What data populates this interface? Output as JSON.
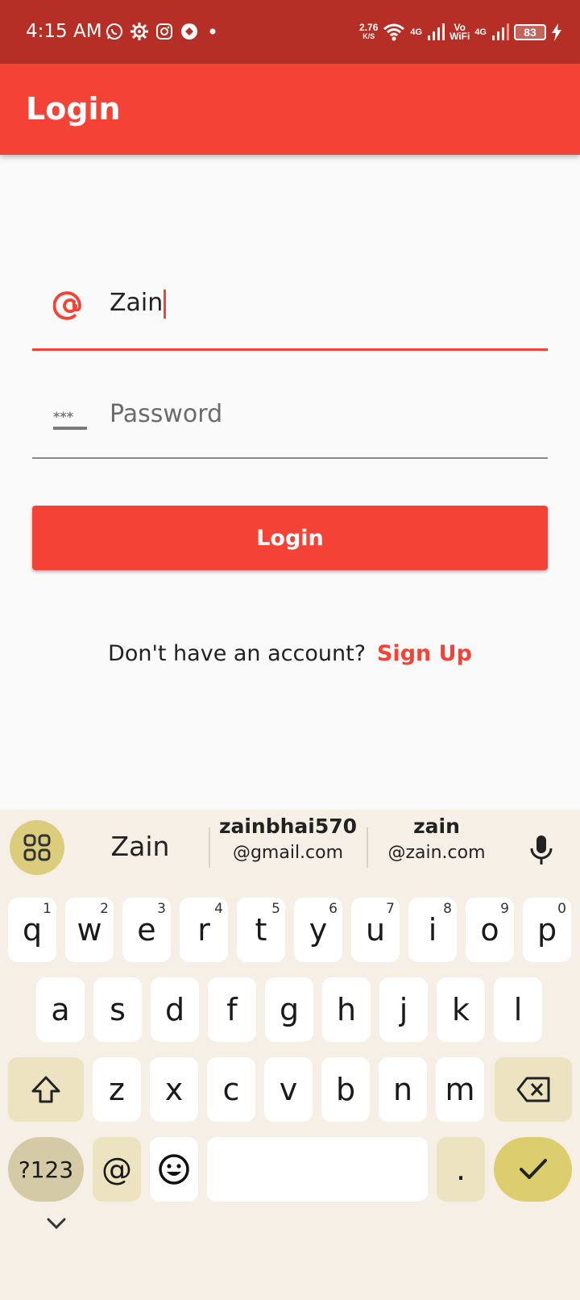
{
  "status_bar": {
    "time": "4:15 AM",
    "icons": [
      "whatsapp-icon",
      "settings-icon",
      "instagram-icon",
      "camera-app-icon",
      "dot-icon"
    ],
    "net_speed_value": "2.76",
    "net_speed_unit": "K/S",
    "net1": "4G",
    "volte": "Vo",
    "wifi_label": "WiFi",
    "net2": "4G",
    "battery": "83"
  },
  "appbar": {
    "title": "Login"
  },
  "form": {
    "email": {
      "icon": "at-icon",
      "value": "Zain"
    },
    "password": {
      "icon": "password-icon",
      "placeholder": "Password"
    },
    "login_label": "Login",
    "signup_prompt": "Don't have an account?",
    "signup_link": "Sign Up"
  },
  "keyboard": {
    "suggestions": [
      {
        "line1": "Zain"
      },
      {
        "line1": "zainbhai570",
        "line2": "@gmail.com"
      },
      {
        "line1": "zain",
        "line2": "@zain.com"
      }
    ],
    "rows": [
      [
        {
          "label": "q",
          "sup": "1"
        },
        {
          "label": "w",
          "sup": "2"
        },
        {
          "label": "e",
          "sup": "3"
        },
        {
          "label": "r",
          "sup": "4"
        },
        {
          "label": "t",
          "sup": "5"
        },
        {
          "label": "y",
          "sup": "6"
        },
        {
          "label": "u",
          "sup": "7"
        },
        {
          "label": "i",
          "sup": "8"
        },
        {
          "label": "o",
          "sup": "9"
        },
        {
          "label": "p",
          "sup": "0"
        }
      ],
      [
        {
          "label": "a"
        },
        {
          "label": "s"
        },
        {
          "label": "d"
        },
        {
          "label": "f"
        },
        {
          "label": "g"
        },
        {
          "label": "h"
        },
        {
          "label": "j"
        },
        {
          "label": "k"
        },
        {
          "label": "l"
        }
      ],
      [
        {
          "label": "z"
        },
        {
          "label": "x"
        },
        {
          "label": "c"
        },
        {
          "label": "v"
        },
        {
          "label": "b"
        },
        {
          "label": "n"
        },
        {
          "label": "m"
        }
      ]
    ],
    "sym_label": "?123",
    "at_label": "@",
    "period_label": "."
  }
}
